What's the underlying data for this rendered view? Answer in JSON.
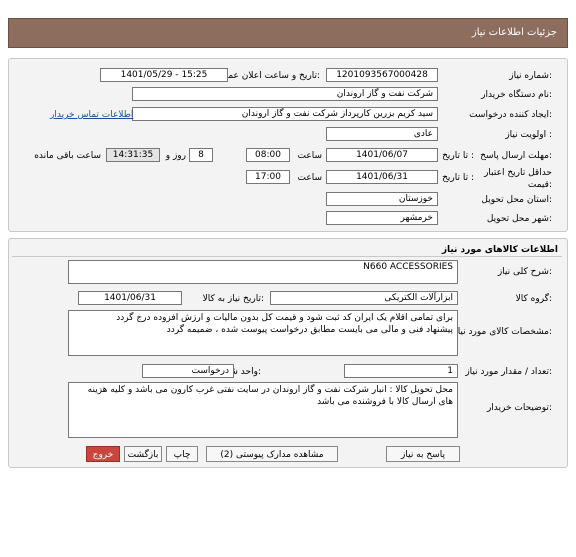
{
  "header": {
    "title": "جزئیات اطلاعات نیاز"
  },
  "info": {
    "need_number_label": "شماره نیاز:",
    "need_number": "1201093567000428",
    "announce_label": "تاریخ و ساعت اعلان عمومی:",
    "announce_value": "1401/05/29 - 15:25",
    "buyer_label": "نام دستگاه خریدار:",
    "buyer": "شرکت نفت و گاز اروندان",
    "creator_label": "ایجاد کننده درخواست:",
    "creator": "سید کریم بزرین کارپرداز شرکت نفت و گاز اروندان",
    "contact_link": "اطلاعات تماس خریدار",
    "priority_label": "اولویت نیاز :",
    "priority": "عادی",
    "send_deadline_label": "مهلت ارسال پاسخ:",
    "to_date_label": "تا تاریخ :",
    "send_date": "1401/06/07",
    "time_label": "ساعت",
    "send_time": "08:00",
    "days": "8",
    "days_label": "روز و",
    "remaining_time": "14:31:35",
    "remaining_label": "ساعت باقی مانده",
    "validity_label": "حداقل تاریخ اعتبار قیمت:",
    "validity_to_label": "تا تاریخ :",
    "validity_date": "1401/06/31",
    "validity_time_label": "ساعت",
    "validity_time": "17:00",
    "province_label": "استان محل تحویل:",
    "province": "خوزستان",
    "city_label": "شهر محل تحویل:",
    "city": "خرمشهر"
  },
  "goods": {
    "section_title": "اطلاعات کالاهای مورد نیاز",
    "summary_label": "شرح کلی نیاز:",
    "summary": "N660 ACCESSORIES",
    "group_label": "گروه کالا:",
    "group": "ابزارآلات الکتریکی",
    "need_date_label": "تاریخ نیاز به کالا:",
    "need_date": "1401/06/31",
    "specs_label": "مشخصات کالای مورد نیاز:",
    "specs": "برای تمامی اقلام یک ایران کد ثبت شود و قیمت کل بدون مالیات و ارزش افزوده درج گردد\nپیشنهاد فنی و مالی می بایست مطابق درخواست پیوست شده ، ضمیمه گردد",
    "qty_label": "تعداد / مقدار مورد نیاز:",
    "qty": "1",
    "unit_label": "واحد شمارش:",
    "unit": "درخواست",
    "notes_label": "توضیحات خریدار:",
    "notes": "محل تحویل کالا : انبار شرکت نفت و گاز اروندان در سایت نفتی غرب کارون می باشد و کلیه هزینه های ارسال کالا با فروشنده می باشد"
  },
  "buttons": {
    "reply": "پاسخ به نیاز",
    "attachments": "مشاهده مدارک پیوستی (2)",
    "print": "چاپ",
    "back": "بازگشت",
    "exit": "خروج"
  }
}
